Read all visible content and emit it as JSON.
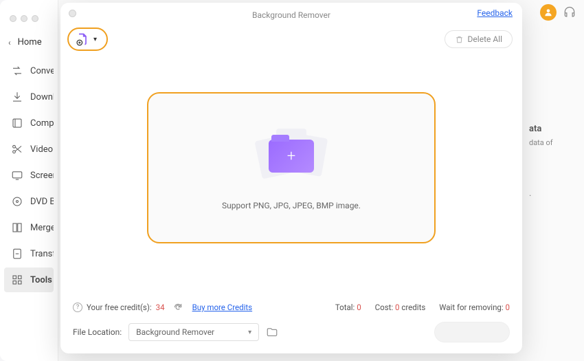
{
  "sidebar": {
    "home": "Home",
    "items": [
      {
        "label": "Converter",
        "icon": "convert"
      },
      {
        "label": "Downloader",
        "icon": "download"
      },
      {
        "label": "Compressor",
        "icon": "compress"
      },
      {
        "label": "Video Editor",
        "icon": "scissors"
      },
      {
        "label": "Screen Recorder",
        "icon": "screen"
      },
      {
        "label": "DVD Burner",
        "icon": "disc"
      },
      {
        "label": "Merger",
        "icon": "merge"
      },
      {
        "label": "Transfer",
        "icon": "transfer"
      },
      {
        "label": "Tools",
        "icon": "grid"
      }
    ]
  },
  "bg_panel": {
    "title": "ata",
    "sub": "data of",
    "ellipsis": "."
  },
  "modal": {
    "title": "Background Remover",
    "feedback": "Feedback",
    "delete_all": "Delete All",
    "drop_text": "Support PNG, JPG, JPEG, BMP image.",
    "credits": {
      "label": "Your free credit(s):",
      "value": "34",
      "buy": "Buy more Credits",
      "total_label": "Total:",
      "total_value": "0",
      "cost_label": "Cost:",
      "cost_value": "0",
      "cost_unit": "credits",
      "wait_label": "Wait for removing:",
      "wait_value": "0"
    },
    "location": {
      "label": "File Location:",
      "value": "Background Remover"
    },
    "highlight_color": "#f0a020",
    "accent_purple": "#9b6bff"
  }
}
